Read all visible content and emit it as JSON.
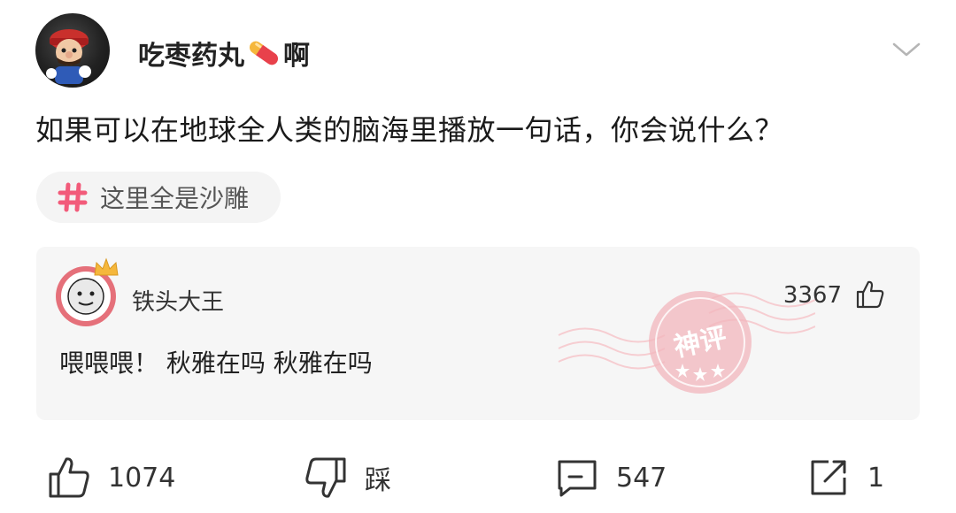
{
  "post": {
    "author": "吃枣药丸",
    "author_suffix": "啊",
    "question": "如果可以在地球全人类的脑海里播放一句话，你会说什么？",
    "topic": "这里全是沙雕"
  },
  "top_comment": {
    "author": "铁头大王",
    "likes": "3367",
    "text": "喂喂喂！ 秋雅在吗 秋雅在吗",
    "stamp_label": "神评"
  },
  "actions": {
    "like_count": "1074",
    "dislike_label": "踩",
    "comment_count": "547",
    "share_count": "1"
  },
  "colors": {
    "stamp": "#f0a6ad",
    "pill_red": "#e8414b",
    "pill_yellow": "#f5b73c",
    "hash": "#f25b7a"
  }
}
